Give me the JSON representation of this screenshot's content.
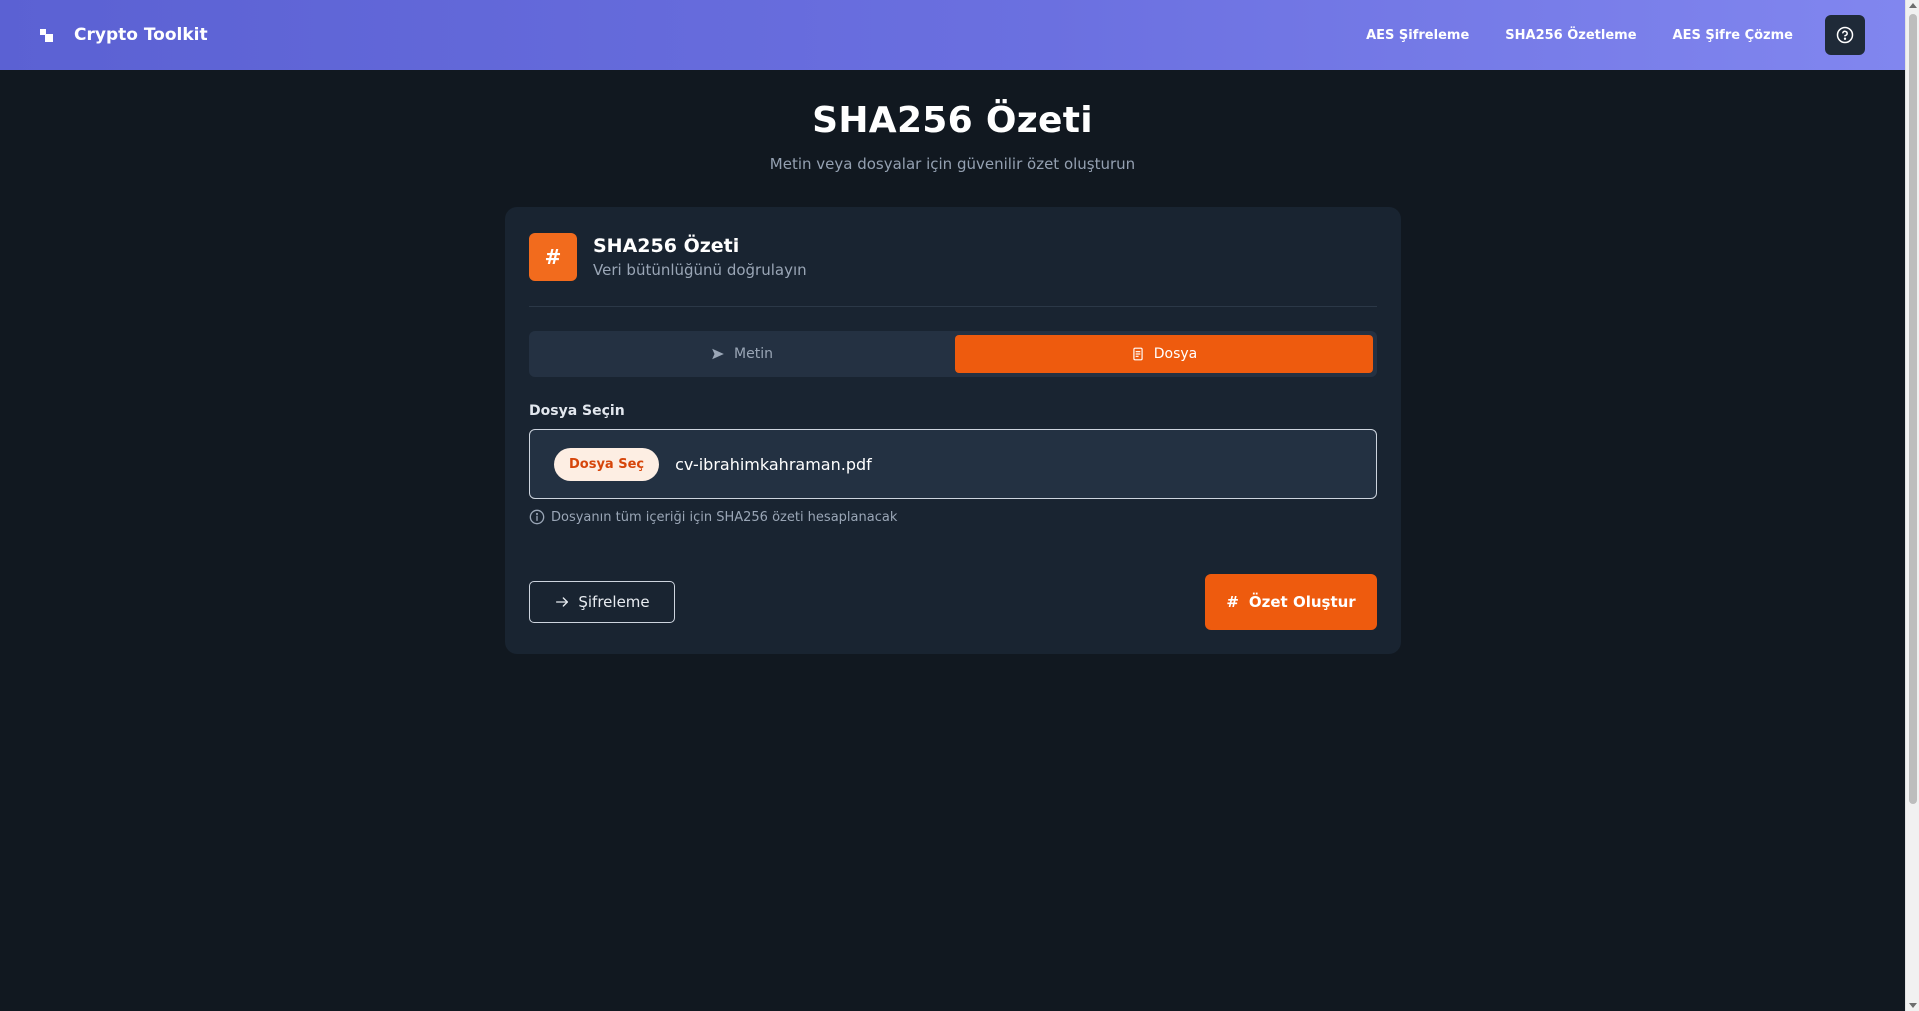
{
  "navbar": {
    "brand": "Crypto Toolkit",
    "links": [
      "AES Şifreleme",
      "SHA256 Özetleme",
      "AES Şifre Çözme"
    ],
    "help_icon": "question-circle-icon"
  },
  "hero": {
    "title": "SHA256 Özeti",
    "subtitle": "Metin veya dosyalar için güvenilir özet oluşturun"
  },
  "card": {
    "badge": "#",
    "title": "SHA256 Özeti",
    "description": "Veri bütünlüğünü doğrulayın",
    "tabs": [
      {
        "label": "Metin",
        "icon": "send-icon",
        "active": false
      },
      {
        "label": "Dosya",
        "icon": "document-icon",
        "active": true
      }
    ],
    "file_label": "Dosya Seçin",
    "file_button": "Dosya Seç",
    "file_name": "cv-ibrahimkahraman.pdf",
    "hint": "Dosyanın tüm içeriği için SHA256 özeti hesaplanacak",
    "secondary_button": "Şifreleme",
    "primary_button_icon": "#",
    "primary_button": "Özet Oluştur"
  },
  "colors": {
    "accent": "#ee5b0e",
    "nav_start": "#5b61d3",
    "nav_end": "#8186ef",
    "background": "#111820",
    "card": "#192431"
  }
}
